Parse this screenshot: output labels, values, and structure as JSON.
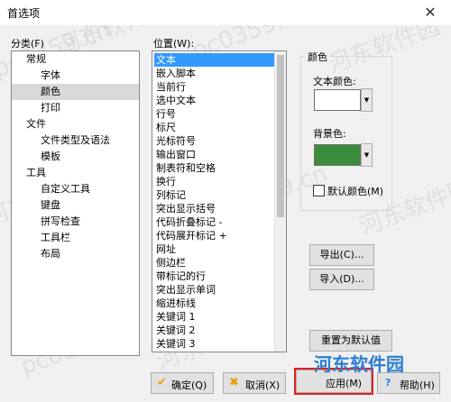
{
  "window": {
    "title": "首选项",
    "close_glyph": "✕"
  },
  "category": {
    "label": "分类(F)",
    "items": [
      {
        "label": "常规"
      },
      {
        "label": "字体"
      },
      {
        "label": "颜色"
      },
      {
        "label": "打印"
      },
      {
        "label": "文件"
      },
      {
        "label": "文件类型及语法"
      },
      {
        "label": "模板"
      },
      {
        "label": "工具"
      },
      {
        "label": "自定义工具"
      },
      {
        "label": "键盘"
      },
      {
        "label": "拼写检查"
      },
      {
        "label": "工具栏"
      },
      {
        "label": "布局"
      }
    ],
    "selected": "颜色"
  },
  "position": {
    "label": "位置(W):",
    "items": [
      "文本",
      "嵌入脚本",
      "当前行",
      "选中文本",
      "行号",
      "标尺",
      "光标符号",
      "输出窗口",
      "制表符和空格",
      "换行",
      "列标记",
      "突出显示括号",
      "代码折叠标记 -",
      "代码展开标记 +",
      "网址",
      "侧边栏",
      "带标记的行",
      "突出显示单词",
      "缩进标线",
      "关键词 1",
      "关键词 2",
      "关键词 3"
    ],
    "selected": "文本"
  },
  "color": {
    "group_label": "颜色",
    "text_color_label": "文本颜色:",
    "text_color": "#ffffff",
    "bg_color_label": "背景色:",
    "bg_color": "#3a8d3a",
    "default_label": "默认颜色(M)",
    "dropdown_glyph": "▼"
  },
  "side_buttons": {
    "export": "导出(C)...",
    "import": "导入(D)...",
    "reset": "重置为默认值"
  },
  "bottom_buttons": {
    "ok": "确定(Q)",
    "ok_icon": "✔",
    "cancel": "取消(X)",
    "cancel_icon": "✖",
    "apply": "应用(M)",
    "help": "帮助(H)",
    "help_icon": "?"
  },
  "watermark": {
    "site": "pc0359.cn",
    "brand": "河东软件园"
  }
}
